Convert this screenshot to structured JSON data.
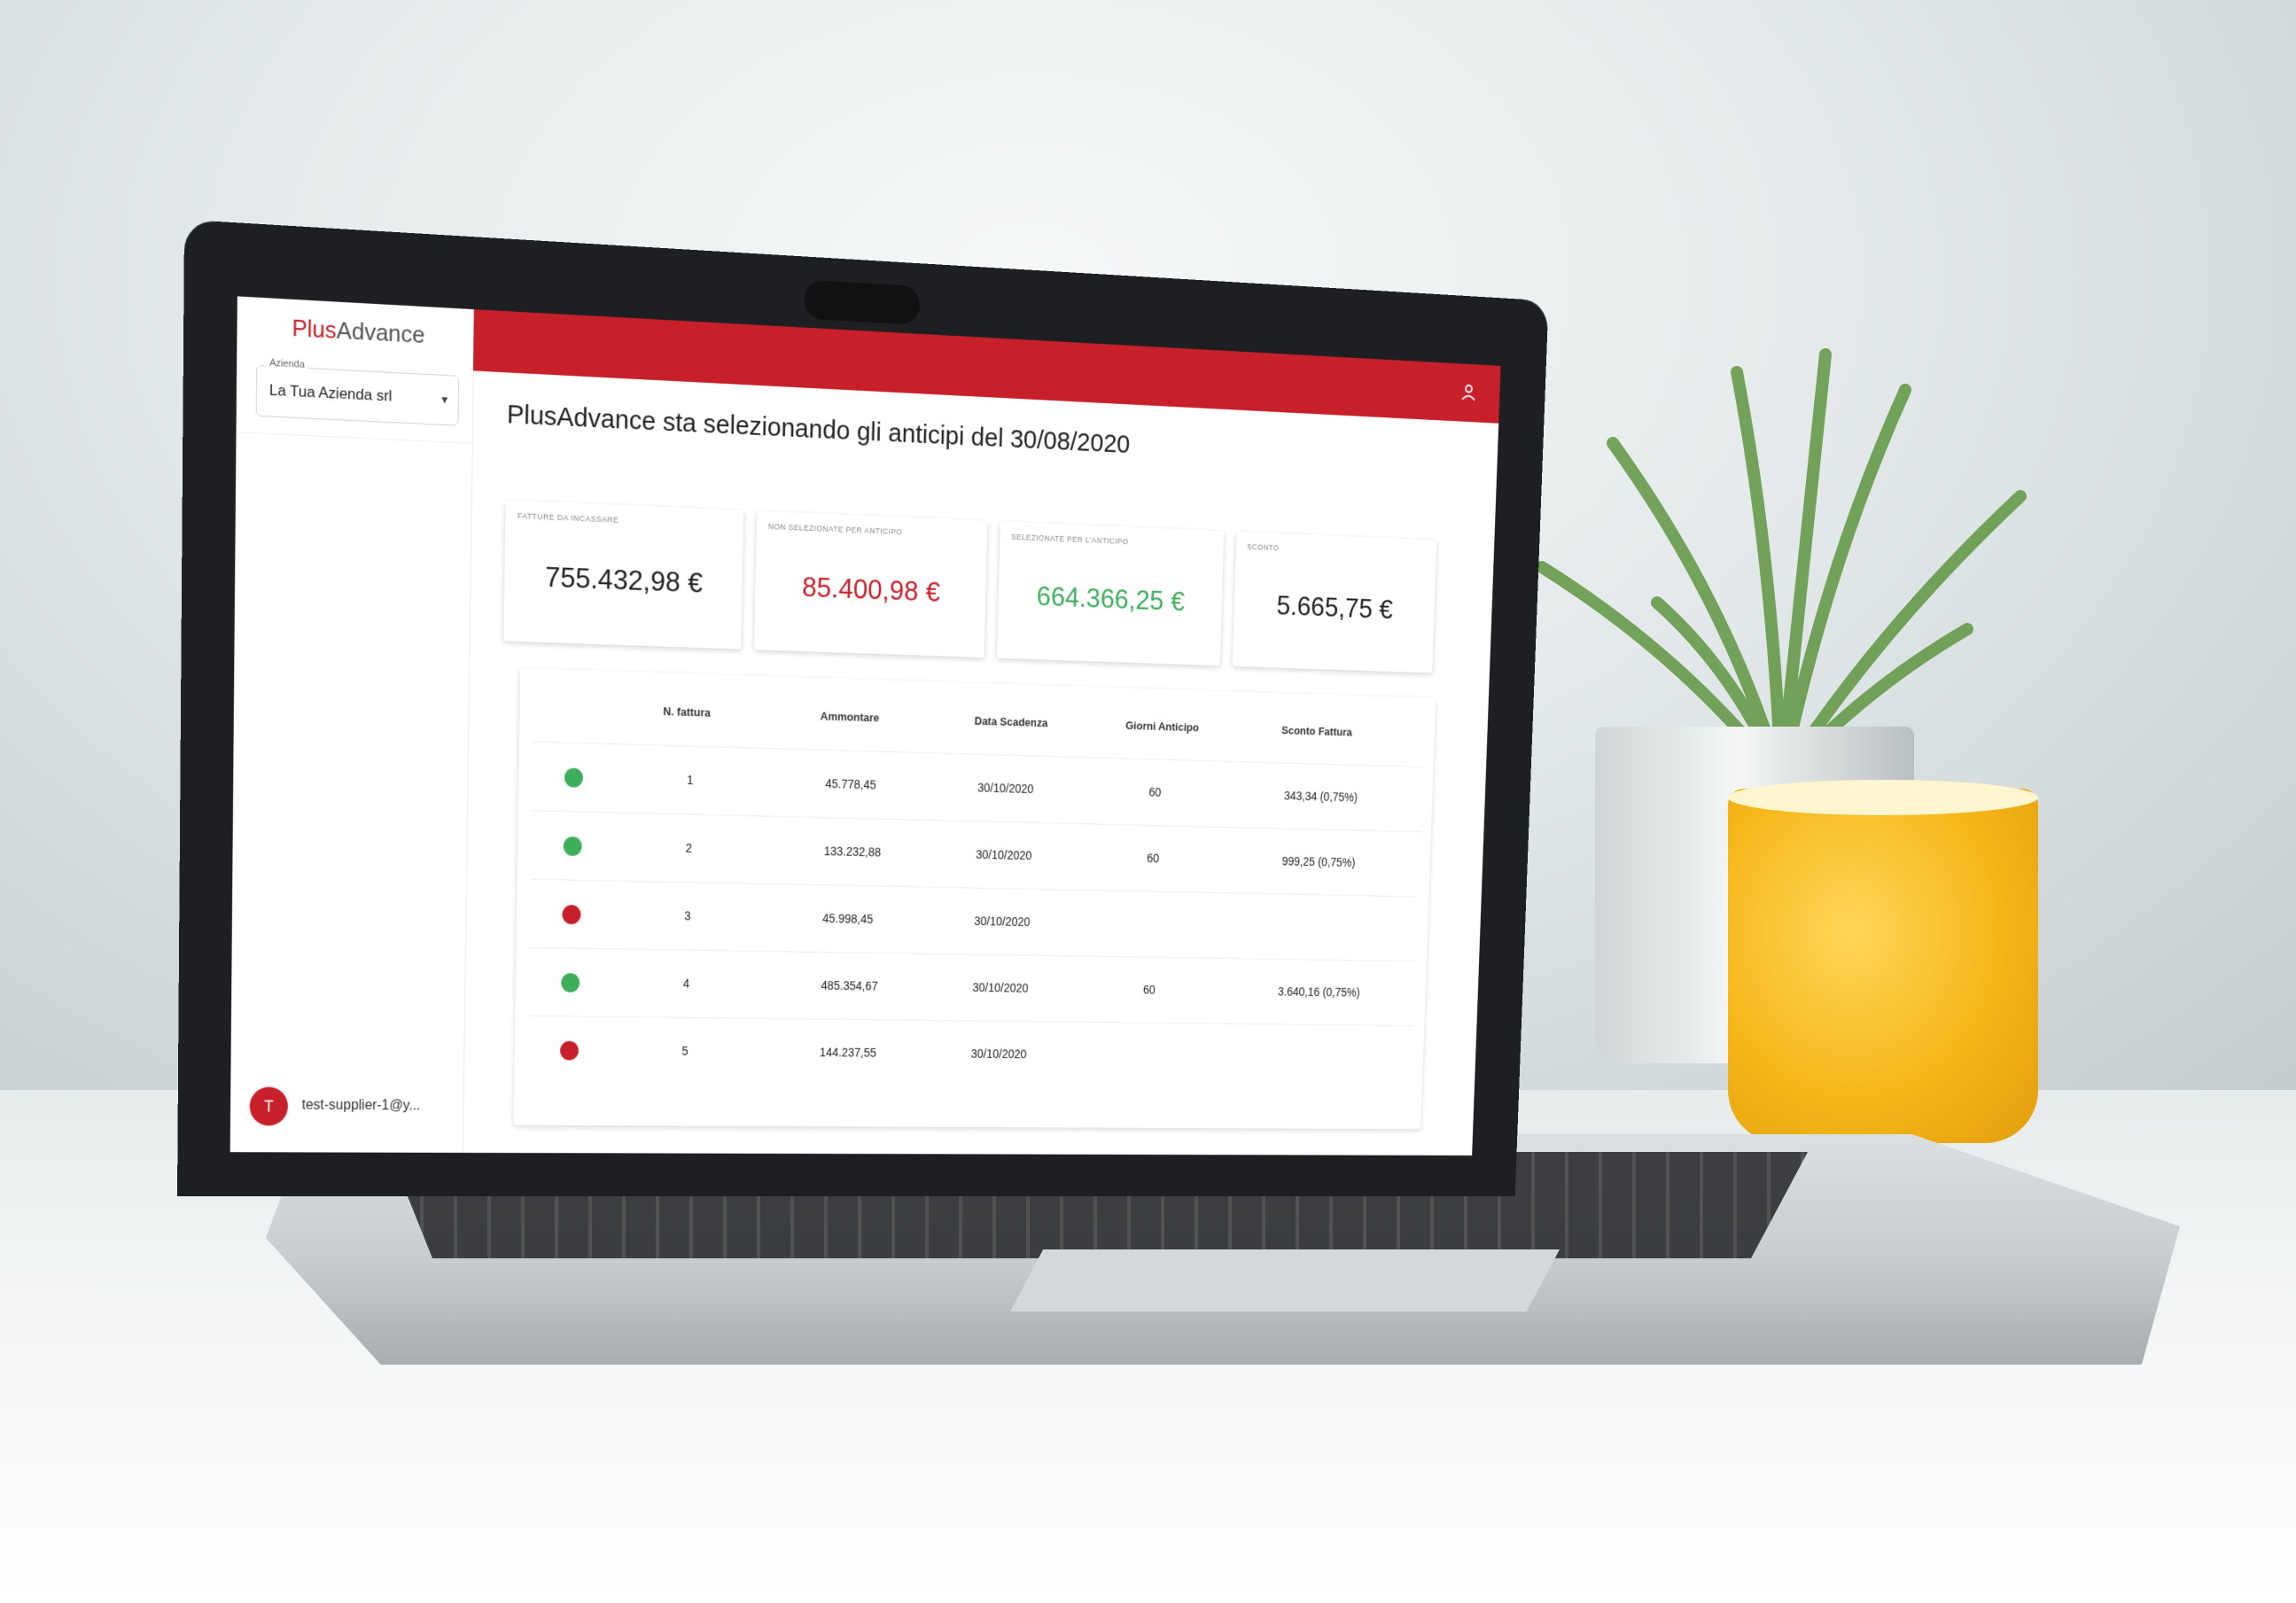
{
  "app": {
    "logo": {
      "plus": "Plus",
      "advance": "Advance"
    },
    "company_select": {
      "label": "Azienda",
      "value": "La Tua Azienda srl"
    },
    "user": {
      "initial": "T",
      "email": "test-supplier-1@y..."
    },
    "page_title": "PlusAdvance sta selezionando gli anticipi del 30/08/2020",
    "cards": [
      {
        "label": "FATTURE DA INCASSARE",
        "value": "755.432,98 €",
        "color": "#222222"
      },
      {
        "label": "NON SELEZIONATE PER ANTICIPO",
        "value": "85.400,98 €",
        "color": "#c8202a"
      },
      {
        "label": "SELEZIONATE PER L'ANTICIPO",
        "value": "664.366,25 €",
        "color": "#3fae5c"
      },
      {
        "label": "SCONTO",
        "value": "5.665,75 €",
        "color": "#222222"
      }
    ],
    "table": {
      "headers": [
        "N. fattura",
        "Ammontare",
        "Data Scadenza",
        "Giorni Anticipo",
        "Sconto Fattura"
      ],
      "rows": [
        {
          "status": "green",
          "n": "1",
          "amount": "45.778,45",
          "date": "30/10/2020",
          "days": "60",
          "discount": "343,34 (0,75%)"
        },
        {
          "status": "green",
          "n": "2",
          "amount": "133.232,88",
          "date": "30/10/2020",
          "days": "60",
          "discount": "999,25 (0,75%)"
        },
        {
          "status": "red",
          "n": "3",
          "amount": "45.998,45",
          "date": "30/10/2020",
          "days": "",
          "discount": ""
        },
        {
          "status": "green",
          "n": "4",
          "amount": "485.354,67",
          "date": "30/10/2020",
          "days": "60",
          "discount": "3.640,16 (0,75%)"
        },
        {
          "status": "red",
          "n": "5",
          "amount": "144.237,55",
          "date": "30/10/2020",
          "days": "",
          "discount": ""
        }
      ]
    },
    "colors": {
      "brand_red": "#c8202a",
      "status_green": "#3fae5c",
      "status_red": "#c8202a"
    }
  }
}
